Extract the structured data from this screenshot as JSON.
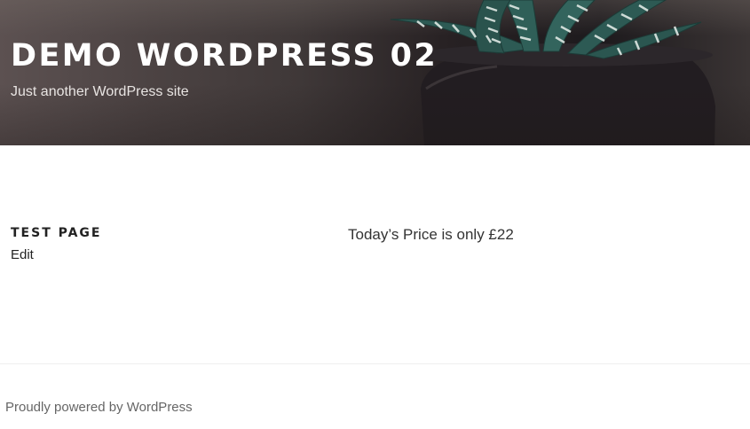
{
  "header": {
    "site_title": "DEMO WORDPRESS 02",
    "tagline": "Just another WordPress site"
  },
  "content": {
    "page_title": "TEST PAGE",
    "edit_link": "Edit",
    "body_text": "Today’s Price is only £22"
  },
  "footer": {
    "credit": "Proudly powered by WordPress"
  },
  "colors": {
    "header_text": "#ffffff",
    "body_text": "#222222",
    "footer_text": "#666666"
  }
}
